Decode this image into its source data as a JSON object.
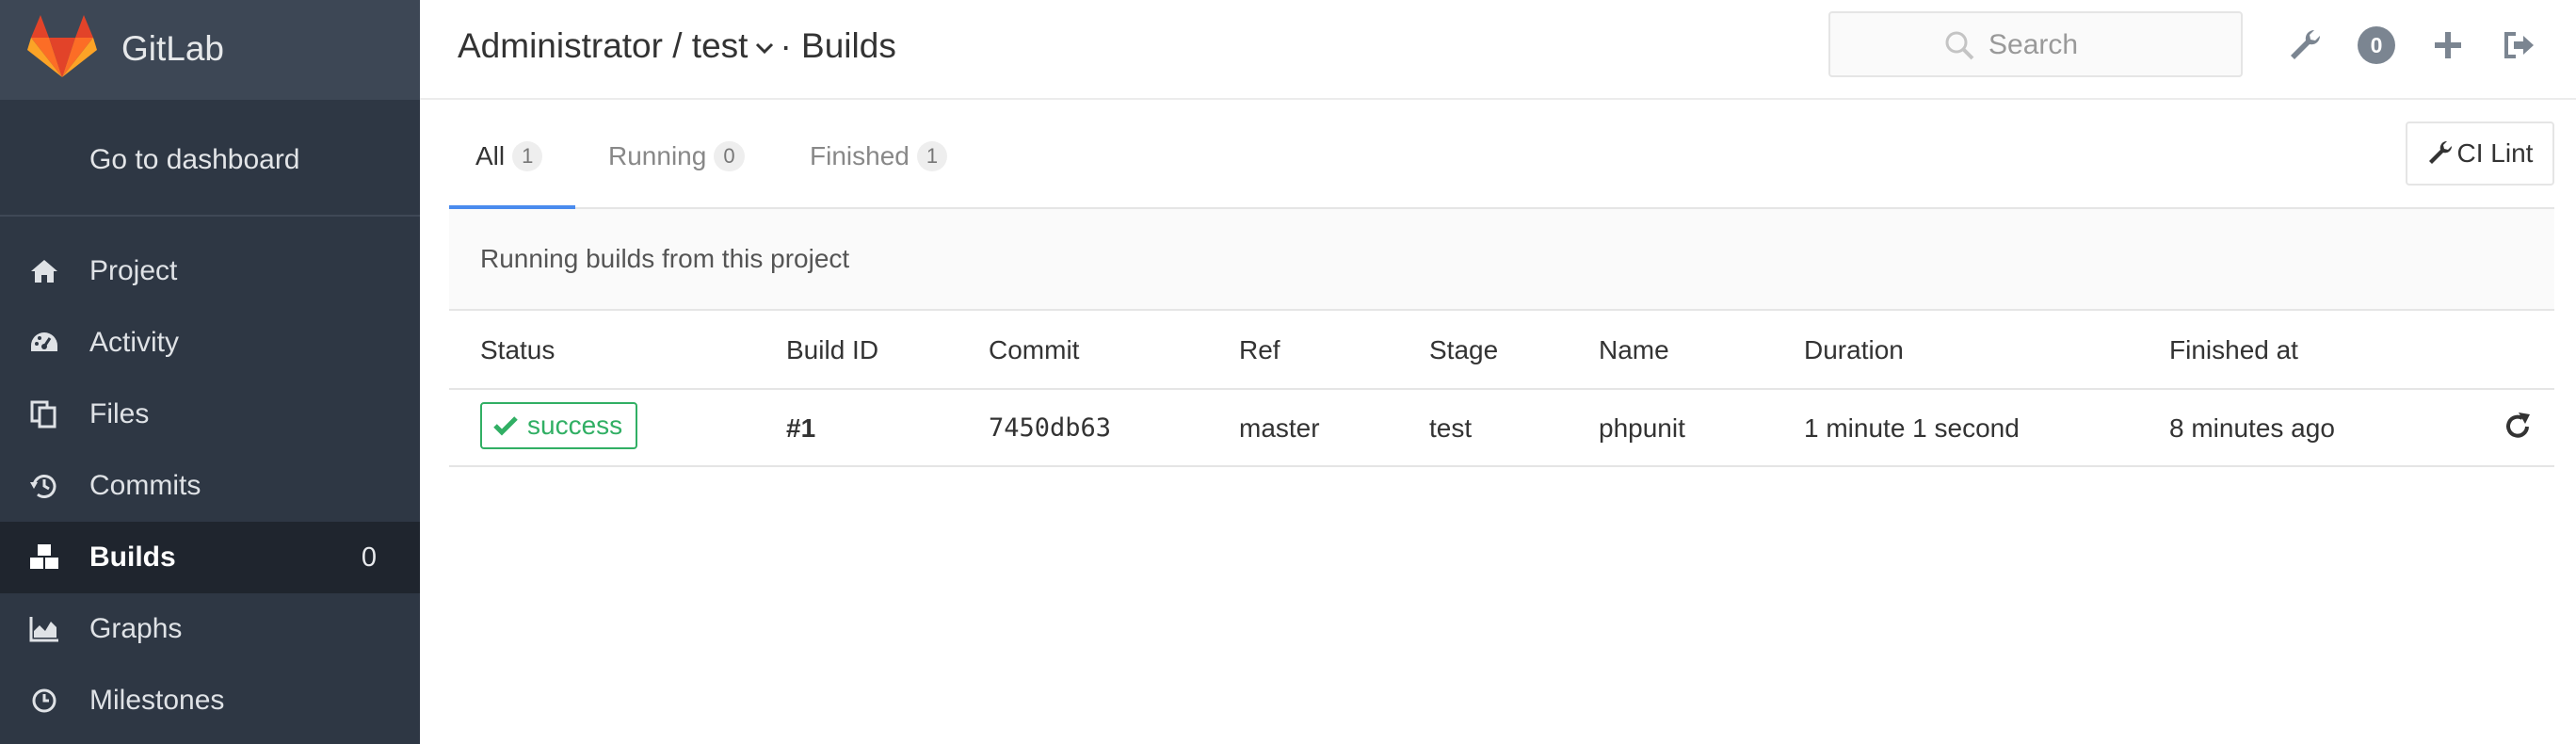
{
  "brand": {
    "name": "GitLab"
  },
  "sidebar": {
    "dashboard_label": "Go to dashboard",
    "items": [
      {
        "label": "Project",
        "icon": "home-icon"
      },
      {
        "label": "Activity",
        "icon": "dashboard-icon"
      },
      {
        "label": "Files",
        "icon": "files-icon"
      },
      {
        "label": "Commits",
        "icon": "history-icon"
      },
      {
        "label": "Builds",
        "icon": "cubes-icon",
        "count": "0",
        "active": true
      },
      {
        "label": "Graphs",
        "icon": "area-chart-icon"
      },
      {
        "label": "Milestones",
        "icon": "clock-icon"
      }
    ]
  },
  "header": {
    "breadcrumb_project": "Administrator / test",
    "breadcrumb_page": "· Builds",
    "search_placeholder": "Search",
    "todo_count": "0"
  },
  "tabs": [
    {
      "label": "All",
      "count": "1",
      "active": true
    },
    {
      "label": "Running",
      "count": "0"
    },
    {
      "label": "Finished",
      "count": "1"
    }
  ],
  "ci_lint_label": "CI Lint",
  "info_text": "Running builds from this project",
  "table": {
    "columns": [
      "Status",
      "Build ID",
      "Commit",
      "Ref",
      "Stage",
      "Name",
      "Duration",
      "Finished at"
    ],
    "rows": [
      {
        "status": "success",
        "build_id": "#1",
        "commit": "7450db63",
        "ref": "master",
        "stage": "test",
        "name": "phpunit",
        "duration": "1 minute 1 second",
        "finished_at": "8 minutes ago"
      }
    ]
  },
  "colors": {
    "sidebar_bg": "#2e3744",
    "sidebar_active_bg": "#1f252e",
    "accent": "#4a8bee",
    "success": "#31af64",
    "logo_orange": "#fc6d26"
  }
}
